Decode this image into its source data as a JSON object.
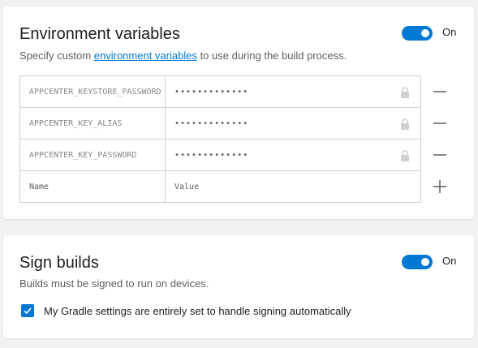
{
  "env_section": {
    "title": "Environment variables",
    "desc_prefix": "Specify custom ",
    "desc_link": "environment variables",
    "desc_suffix": " to use during the build process.",
    "toggle_label": "On",
    "rows": [
      {
        "name": "APPCENTER_KEYSTORE_PASSWORD",
        "value": "•••••••••••••"
      },
      {
        "name": "APPCENTER_KEY_ALIAS",
        "value": "•••••••••••••"
      },
      {
        "name": "APPCENTER_KEY_PASSWORD",
        "value": "•••••••••••••"
      }
    ],
    "new_row": {
      "name_placeholder": "Name",
      "value_placeholder": "Value"
    }
  },
  "sign_section": {
    "title": "Sign builds",
    "desc": "Builds must be signed to run on devices.",
    "toggle_label": "On",
    "checkbox_label": "My Gradle settings are entirely set to handle signing automatically"
  },
  "colors": {
    "accent": "#0078d4",
    "background": "#f3f2f1",
    "card": "#ffffff",
    "border": "#d2d0ce"
  },
  "icons": {
    "lock": "lock-icon",
    "remove": "minus-icon",
    "add": "plus-icon",
    "check": "checkmark-icon"
  }
}
